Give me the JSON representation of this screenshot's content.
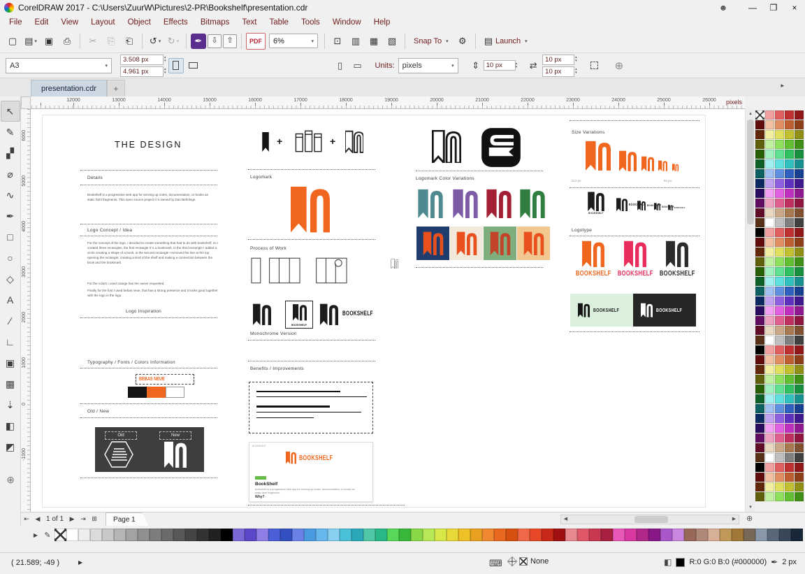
{
  "window": {
    "title": "CorelDRAW 2017 - C:\\Users\\ZuurW\\Pictures\\2-PR\\Bookshelf\\presentation.cdr",
    "minimize": "—",
    "maximize": "❐",
    "close": "×",
    "user": "☻"
  },
  "menubar": {
    "items": [
      "File",
      "Edit",
      "View",
      "Layout",
      "Object",
      "Effects",
      "Bitmaps",
      "Text",
      "Table",
      "Tools",
      "Window",
      "Help"
    ]
  },
  "toolbar": {
    "zoom_value": "6%",
    "pdf_label": "PDF",
    "snap_label": "Snap To",
    "launch_label": "Launch",
    "items": [
      {
        "name": "new-document",
        "glyph": "▢"
      },
      {
        "name": "open",
        "glyph": "▤",
        "drop": true
      },
      {
        "name": "save",
        "glyph": "▣"
      },
      {
        "name": "print",
        "glyph": "⎙"
      },
      {
        "sep": true
      },
      {
        "name": "cut",
        "glyph": "✂",
        "disabled": true
      },
      {
        "name": "copy",
        "glyph": "⎘",
        "disabled": true
      },
      {
        "name": "paste",
        "glyph": "⎗"
      },
      {
        "sep": true
      },
      {
        "name": "undo",
        "glyph": "↺",
        "drop": true
      },
      {
        "name": "redo",
        "glyph": "↻",
        "drop": true,
        "disabled": true
      },
      {
        "sep": true
      },
      {
        "name": "search-content",
        "glyph": "✒",
        "chip": true
      },
      {
        "name": "import",
        "glyph": "⇩",
        "box": true
      },
      {
        "name": "export",
        "glyph": "⇧",
        "box": true
      },
      {
        "sep": true
      },
      {
        "name": "publish-to-pdf",
        "pdf": true
      },
      {
        "name": "zoom-levels",
        "zoom": true
      },
      {
        "sep": true
      },
      {
        "name": "full-screen-preview",
        "glyph": "⊡"
      },
      {
        "name": "show-rulers",
        "glyph": "▥"
      },
      {
        "name": "show-grid",
        "glyph": "▦"
      },
      {
        "name": "show-guidelines",
        "glyph": "▧"
      },
      {
        "sep": true
      },
      {
        "name": "snap-to",
        "snap": true
      },
      {
        "name": "options",
        "glyph": "⚙"
      },
      {
        "sep": true
      },
      {
        "name": "launch",
        "launch": true
      }
    ]
  },
  "propbar": {
    "page_size": "A3",
    "width_value": "3.508 px",
    "height_value": "4.961 px",
    "units_label": "Units:",
    "units_value": "pixels",
    "nudge_value": "10 px",
    "dup_x": "10 px",
    "dup_y": "10 px"
  },
  "tabs": {
    "document": "presentation.cdr",
    "add": "+"
  },
  "ruler": {
    "h_numbers": [
      "12000",
      "13000",
      "14000",
      "15000",
      "16000",
      "17000",
      "18000",
      "19000",
      "20000",
      "21000",
      "22000",
      "23000",
      "24000",
      "25000",
      "26000"
    ],
    "v_numbers": [
      "6000",
      "5000",
      "4000",
      "3000",
      "2000",
      "1000",
      "0",
      "-1000"
    ],
    "unit": "pixels"
  },
  "toolbox": {
    "add_glyph": "⊕",
    "tools": [
      {
        "name": "pick-tool",
        "glyph": "↖"
      },
      {
        "name": "shape-tool",
        "glyph": "✎"
      },
      {
        "name": "crop-tool",
        "glyph": "▞"
      },
      {
        "name": "zoom-tool",
        "glyph": "⌀"
      },
      {
        "name": "freehand-tool",
        "glyph": "∿"
      },
      {
        "name": "artistic-media-tool",
        "glyph": "✒"
      },
      {
        "name": "rectangle-tool",
        "glyph": "□"
      },
      {
        "name": "ellipse-tool",
        "glyph": "○"
      },
      {
        "name": "polygon-tool",
        "glyph": "◇"
      },
      {
        "name": "text-tool",
        "glyph": "A"
      },
      {
        "name": "dimension-tool",
        "glyph": "∕"
      },
      {
        "name": "connector-tool",
        "glyph": "∟"
      },
      {
        "name": "contour-tool",
        "glyph": "▣"
      },
      {
        "name": "transparency-tool",
        "glyph": "▦"
      },
      {
        "name": "eyedropper-tool",
        "glyph": "⇣"
      },
      {
        "name": "interactive-fill-tool",
        "glyph": "◧"
      },
      {
        "name": "smart-fill-tool",
        "glyph": "◩"
      }
    ]
  },
  "canvas": {
    "title": "THE DESIGN",
    "details_label": "Details",
    "details_text": "Bookshelf is a progressive web app for serving up notes, documentation, or books as static html fragments. This open source project it 's owned by Dan Behrlings.",
    "concept_label": "Logo Concept / Idea",
    "concept_p1": "For the concept of the logo, I decided to create something that had to do with bookshelf, so I created three rectangles, the first rectangle it' s a bookmark, in the third rectangle I added a circle creating a shape of a book, in the second rectangle I removed the line at the top opening the rectangle, creating a kind of the shelf and making a connection between the book and the bookmark.",
    "concept_p2": "For the colors I used orange has the owner requested.",
    "concept_p3": "Finally for the font I used bebas neue, that has a strong presence and it looks good together with the logo in the logo.",
    "inspiration_label": "Logo Inspiration",
    "typography_label": "Typography / Fonts / Colors Information",
    "font_name": "BEBAS NEUE",
    "oldnew_label": "Old / New",
    "old_label": "Old",
    "new_label": "New",
    "logomark_label": "Logomark",
    "process_label": "Process of Work",
    "monochrome_label": "Monochrome Version",
    "benefits_label": "Benefits / Improvements",
    "variations_label": "Logomark Color Variations",
    "sizes_label": "Size Variations",
    "size_large": "512 px",
    "size_small": "64 px",
    "logotype_label": "Logotype",
    "bookshelf": "BOOKSHELF",
    "plus": "+",
    "web": {
      "brand": "BOOKSHELF",
      "title": "BookShelf",
      "desc": "bookshelf is a progressive web app for serving up notes, documentation, or books as static html fragments.",
      "why": "Why?"
    },
    "colors": {
      "orange": "#f0661e",
      "pink": "#e82c5c",
      "black": "#1c1c1c",
      "white": "#ffffff"
    },
    "variation_row1": [
      "#4e8a8f",
      "#7e5ba6",
      "#a31f34",
      "#2f7d3f"
    ],
    "variation_row2": [
      {
        "bg": "#1e3c6e",
        "logo": "#e8511d"
      },
      {
        "bg": "#f2e9da",
        "logo": "#e8511d"
      },
      {
        "bg": "#7fae7e",
        "logo": "#c2452a"
      },
      {
        "bg": "#f2c890",
        "logo": "#e8511d"
      }
    ],
    "logotype_vertical": [
      "#f0661e",
      "#e82c5c",
      "#2b2b2b"
    ],
    "logotype_horizontal": [
      {
        "bg": "#daf0dc",
        "fg": "#151515"
      },
      {
        "bg": "#262626",
        "fg": "#ffffff"
      }
    ]
  },
  "pagenav": {
    "first": "⇤",
    "prev": "◀",
    "info": "1 of 1",
    "next": "▶",
    "last": "⇥",
    "add": "⊞",
    "page_tab": "Page 1"
  },
  "statusbar": {
    "coords": "( 21.589; -49 )",
    "fill_none_label": "None",
    "color_text": "R:0 G:0 B:0 (#000000)",
    "outline_width": "2 px"
  },
  "palettes": {
    "right": [
      "#f0a0a0",
      "#e06060",
      "#c03030",
      "#901818",
      "#600c0c",
      "#f0c0a0",
      "#e09060",
      "#c06030",
      "#904018",
      "#602808",
      "#f0f0a0",
      "#e0e060",
      "#c0c030",
      "#909018",
      "#60600c",
      "#c0f0a0",
      "#90e060",
      "#60c030",
      "#409018",
      "#286008",
      "#a0f0c0",
      "#60e090",
      "#30c060",
      "#189040",
      "#0c6028",
      "#a0f0f0",
      "#60e0e0",
      "#30c0c0",
      "#189090",
      "#0c6060",
      "#a0c0f0",
      "#6090e0",
      "#3060c0",
      "#184090",
      "#0c2860",
      "#c0a0f0",
      "#9060e0",
      "#6030c0",
      "#401890",
      "#280c60",
      "#f0a0f0",
      "#e060e0",
      "#c030c0",
      "#901890",
      "#600c60",
      "#f0a0c0",
      "#e06090",
      "#c03060",
      "#901840",
      "#600c28",
      "#e8d8c0",
      "#c8a888",
      "#a87850",
      "#805030",
      "#583018",
      "#ffffff",
      "#c0c0c0",
      "#808080",
      "#404040",
      "#000000"
    ],
    "bottom": [
      "#ffffff",
      "#ededed",
      "#dbdbdb",
      "#c8c8c8",
      "#b5b5b5",
      "#a3a3a3",
      "#909090",
      "#7d7d7d",
      "#6b6b6b",
      "#585858",
      "#454545",
      "#333333",
      "#212121",
      "#000000",
      "#7a6ad8",
      "#5a48c8",
      "#8f80e8",
      "#4a5fd8",
      "#3350c0",
      "#6a82e8",
      "#4a9ae0",
      "#66b8ec",
      "#88d0f0",
      "#4ac0d8",
      "#2aa8b8",
      "#50c8a8",
      "#2ab888",
      "#58d858",
      "#38b838",
      "#88d848",
      "#b8e858",
      "#d8e848",
      "#e8d838",
      "#f0c028",
      "#e8a020",
      "#f08830",
      "#e86820",
      "#d85010",
      "#f06848",
      "#e84828",
      "#c82818",
      "#a01010",
      "#e88890",
      "#e05868",
      "#c83850",
      "#a82040",
      "#e858b8",
      "#d838a0",
      "#b02888",
      "#881888",
      "#a858c8",
      "#c888e0",
      "#986858",
      "#b08878",
      "#d8b098",
      "#c09858",
      "#a07838",
      "#786858",
      "#8898a8",
      "#586878",
      "#384858",
      "#182838"
    ]
  }
}
